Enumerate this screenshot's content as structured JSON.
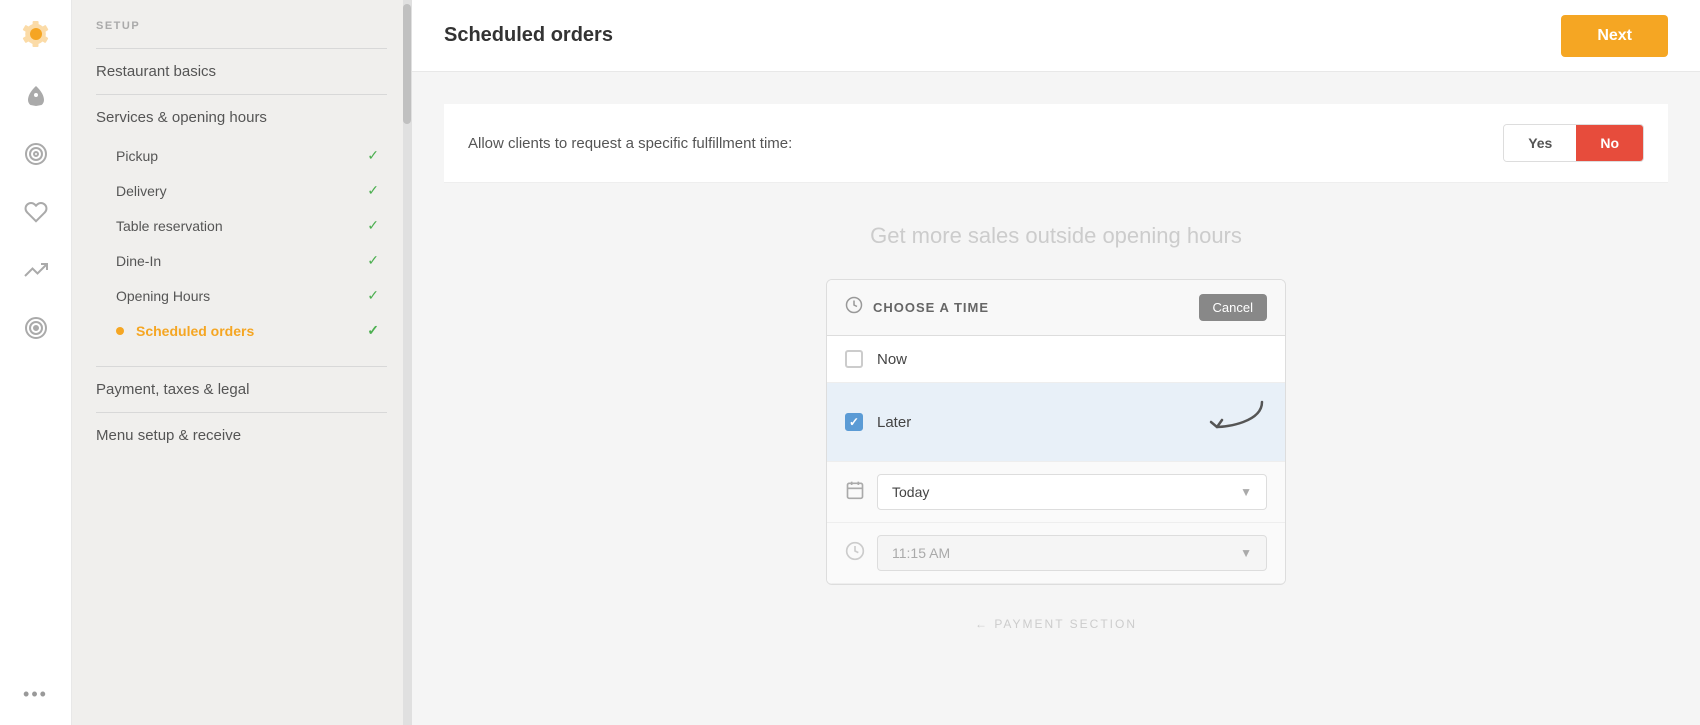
{
  "setup_label": "SETUP",
  "sidebar": {
    "sections": [
      {
        "title": "Restaurant basics",
        "items": []
      },
      {
        "title": "Services & opening hours",
        "items": [
          {
            "label": "Pickup",
            "checked": true,
            "active": false
          },
          {
            "label": "Delivery",
            "checked": true,
            "active": false
          },
          {
            "label": "Table reservation",
            "checked": true,
            "active": false
          },
          {
            "label": "Dine-In",
            "checked": true,
            "active": false
          },
          {
            "label": "Opening Hours",
            "checked": true,
            "active": false
          },
          {
            "label": "Scheduled orders",
            "checked": true,
            "active": true
          }
        ]
      },
      {
        "title": "Payment, taxes & legal",
        "items": []
      },
      {
        "title": "Menu setup & receive",
        "items": []
      }
    ]
  },
  "header": {
    "title": "Scheduled orders",
    "next_label": "Next"
  },
  "fulfillment": {
    "label": "Allow clients to request a specific fulfillment time:",
    "yes_label": "Yes",
    "no_label": "No"
  },
  "promo": {
    "text": "Get more sales outside opening hours"
  },
  "time_chooser": {
    "header_label": "CHOOSE A TIME",
    "cancel_label": "Cancel",
    "options": [
      {
        "label": "Now",
        "checked": false
      },
      {
        "label": "Later",
        "checked": true
      }
    ],
    "date_dropdown": {
      "value": "Today",
      "icon": "📅"
    },
    "time_dropdown": {
      "value": "11:15 AM",
      "icon": "🕐",
      "disabled": true
    }
  },
  "payment_hint": "← PAYMENT SECTION"
}
